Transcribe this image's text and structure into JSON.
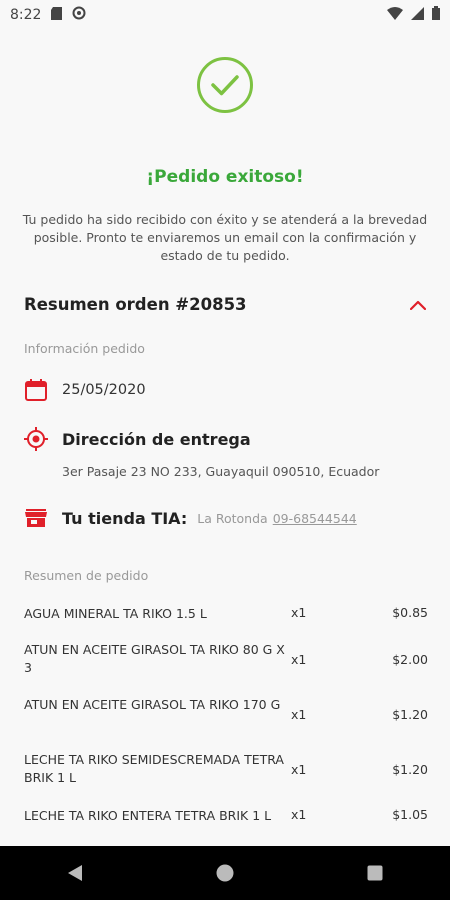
{
  "status_bar": {
    "time": "8:22",
    "icons_left": [
      "sd-card-icon",
      "sync-icon"
    ],
    "icons_right": [
      "wifi-icon",
      "signal-icon",
      "battery-icon"
    ]
  },
  "success": {
    "icon": "check-circle-icon",
    "title": "¡Pedido exitoso!",
    "message": "Tu pedido ha sido recibido con éxito y se atenderá a la brevedad posible. Pronto te enviaremos un email con la confirmación y estado de tu pedido."
  },
  "order": {
    "title": "Resumen orden #20853",
    "collapse_icon": "chevron-up-icon",
    "info_label": "Información pedido",
    "date": "25/05/2020",
    "delivery_label": "Dirección de entrega",
    "address": "3er Pasaje 23 NO 233, Guayaquil 090510, Ecuador",
    "store_label": "Tu tienda TIA:",
    "store_name": "La Rotonda",
    "store_phone": "09-68544544",
    "summary_label": "Resumen de pedido",
    "items": [
      {
        "name": "AGUA MINERAL TA RIKO 1.5 L",
        "qty": "x1",
        "price": "$0.85"
      },
      {
        "name": "ATUN EN ACEITE GIRASOL TA RIKO 80 G X 3",
        "qty": "x1",
        "price": "$2.00"
      },
      {
        "name": "ATUN EN ACEITE GIRASOL TA RIKO 170 G",
        "qty": "x1",
        "price": "$1.20"
      },
      {
        "name": "LECHE TA RIKO SEMIDESCREMADA TETRA BRIK 1 L",
        "qty": "x1",
        "price": "$1.20"
      },
      {
        "name": "LECHE TA RIKO ENTERA TETRA BRIK 1 L",
        "qty": "x1",
        "price": "$1.05"
      }
    ]
  },
  "colors": {
    "success_green": "#3aa83a",
    "accent_red": "#e0202a",
    "background": "#f8f8f8"
  },
  "nav": {
    "buttons": [
      "back-icon",
      "home-icon",
      "recents-icon"
    ]
  }
}
